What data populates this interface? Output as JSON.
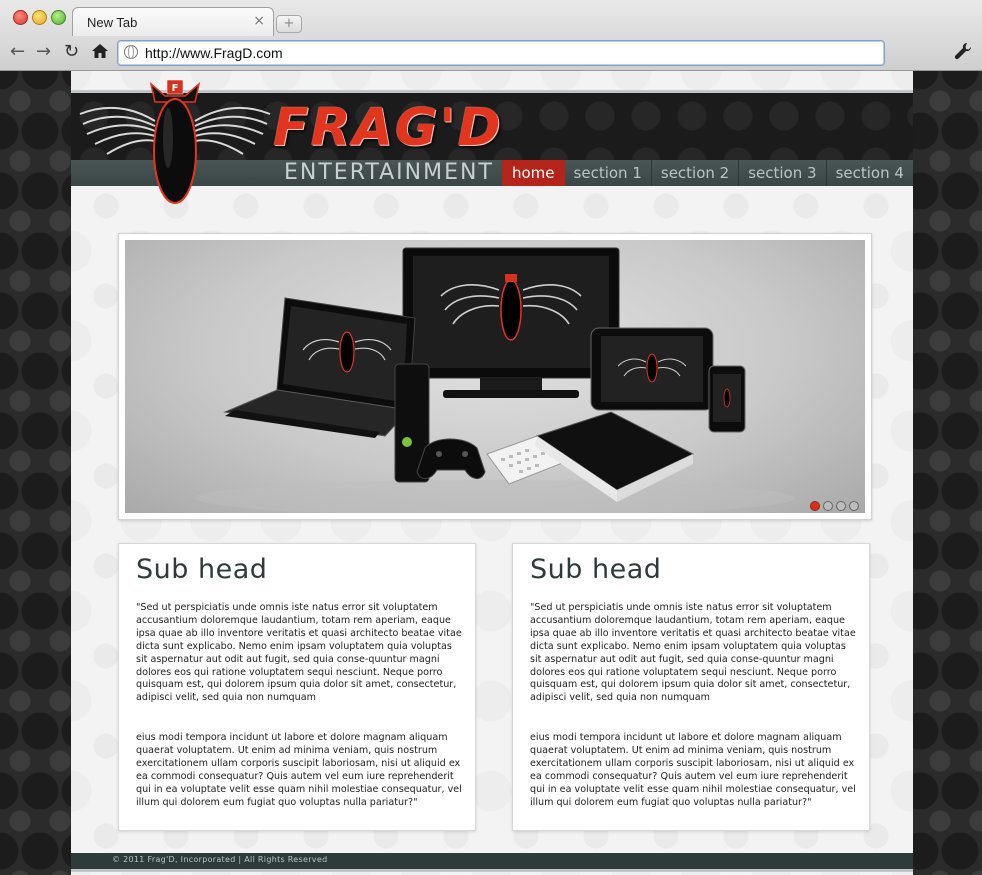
{
  "browser": {
    "tab_title": "New Tab",
    "tab_close": "×",
    "new_tab": "+",
    "url": "http://www.FragD.com"
  },
  "icons": [
    "back-arrow-icon",
    "forward-arrow-icon",
    "reload-icon",
    "home-icon",
    "globe-icon",
    "wrench-icon",
    "bomb-wings-logo-icon"
  ],
  "site": {
    "brand": "FRAG'D",
    "tagline": "ENTERTAINMENT",
    "nav": [
      {
        "label": "home",
        "active": true
      },
      {
        "label": "section 1",
        "active": false
      },
      {
        "label": "section 2",
        "active": false
      },
      {
        "label": "section 3",
        "active": false
      },
      {
        "label": "section 4",
        "active": false
      }
    ],
    "slider": {
      "slide_count": 4,
      "active_slide": 1
    },
    "boxes": [
      {
        "heading": "Sub head",
        "para1": "\"Sed ut perspiciatis unde omnis iste natus error sit voluptatem accusantium doloremque laudantium, totam rem aperiam, eaque ipsa quae ab illo inventore veritatis et quasi architecto beatae vitae dicta sunt explicabo. Nemo enim ipsam voluptatem quia voluptas sit aspernatur aut odit aut fugit, sed quia conse-quuntur magni dolores eos qui ratione voluptatem sequi nesciunt. Neque porro quisquam est, qui dolorem ipsum quia dolor sit amet, consectetur, adipisci velit, sed quia non numquam",
        "para2": "eius modi tempora incidunt ut labore et dolore magnam aliquam quaerat voluptatem. Ut enim ad minima veniam, quis nostrum exercitationem ullam corporis suscipit laboriosam, nisi ut aliquid ex ea commodi consequatur? Quis autem vel eum iure reprehenderit qui in ea voluptate velit esse quam nihil molestiae consequatur, vel illum qui dolorem eum fugiat quo voluptas nulla pariatur?\""
      },
      {
        "heading": "Sub head",
        "para1": "\"Sed ut perspiciatis unde omnis iste natus error sit voluptatem accusantium doloremque laudantium, totam rem aperiam, eaque ipsa quae ab illo inventore veritatis et quasi architecto beatae vitae dicta sunt explicabo. Nemo enim ipsam voluptatem quia voluptas sit aspernatur aut odit aut fugit, sed quia conse-quuntur magni dolores eos qui ratione voluptatem sequi nesciunt. Neque porro quisquam est, qui dolorem ipsum quia dolor sit amet, consectetur, adipisci velit, sed quia non numquam",
        "para2": "eius modi tempora incidunt ut labore et dolore magnam aliquam quaerat voluptatem. Ut enim ad minima veniam, quis nostrum exercitationem ullam corporis suscipit laboriosam, nisi ut aliquid ex ea commodi consequatur? Quis autem vel eum iure reprehenderit qui in ea voluptate velit esse quam nihil molestiae consequatur, vel illum qui dolorem eum fugiat quo voluptas nulla pariatur?\""
      }
    ],
    "footer": "© 2011 Frag'D, Incorporated | All Rights Reserved"
  },
  "colors": {
    "accent_red": "#e3341d",
    "nav_active": "#b5241a",
    "nav_bar": "#3f4b4b",
    "heading": "#2f3a3a"
  }
}
